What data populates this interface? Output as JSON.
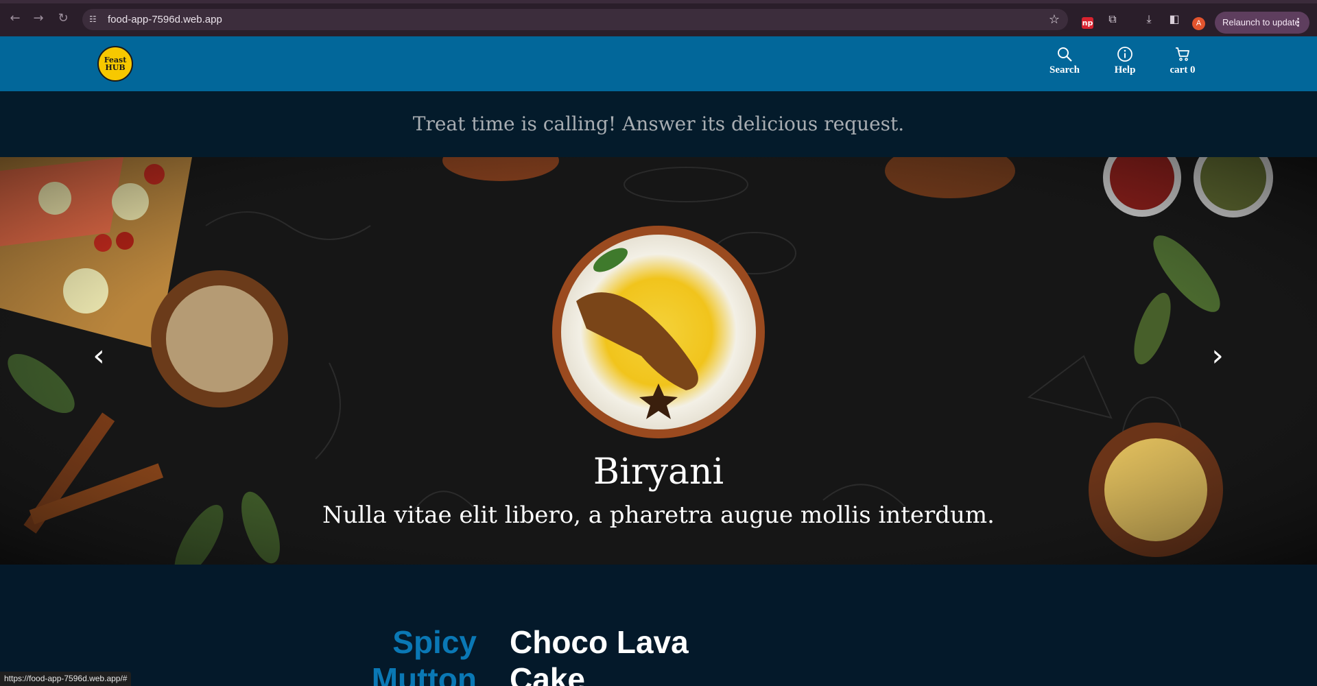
{
  "browser": {
    "url": "food-app-7596d.web.app",
    "relaunch_label": "Relaunch to update",
    "avatar_letter": "A",
    "status_url": "https://food-app-7596d.web.app/#",
    "extension_badge": "np"
  },
  "site": {
    "logo_text_line1": "Feast",
    "logo_text_line2": "HUB",
    "nav": {
      "search_label": "Search",
      "help_label": "Help",
      "cart_label": "cart 0"
    },
    "tagline": "Treat time is calling! Answer its delicious request."
  },
  "hero": {
    "title": "Biryani",
    "subtitle": "Nulla vitae elit libero, a pharetra augue mollis interdum."
  },
  "menu": {
    "item_a_line1": "Spicy",
    "item_a_line2": "Mutton",
    "item_b_line1": "Choco Lava",
    "item_b_line2": "Cake"
  },
  "colors": {
    "header_bg": "#02679a",
    "page_bg": "#04192a",
    "accent_blue": "#0a78b5",
    "logo_yellow": "#f7c800"
  }
}
